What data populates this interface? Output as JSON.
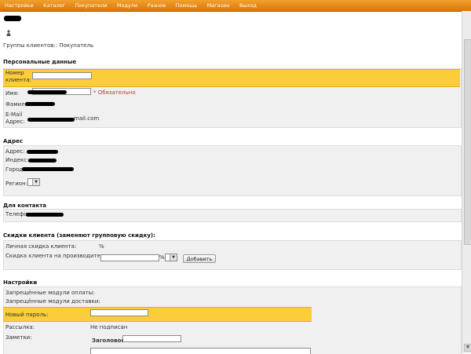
{
  "nav": {
    "items": [
      "Настройки",
      "Каталог",
      "Покупатели",
      "Модули",
      "Разное",
      "Помощь",
      "Магазин",
      "Выход"
    ]
  },
  "header": {
    "breadcrumb": "Группы клиентов:: Покупатель"
  },
  "personal": {
    "title": "Персональные данные",
    "customer_number_label": "Номер клиента:",
    "name_label": "Имя:",
    "required_note": "* Обязательно",
    "surname_label": "Фамилия:",
    "email_label": "E-Mail Адрес:",
    "email_visible": "mail.com"
  },
  "address": {
    "title": "Адрес",
    "address_label": "Адрес:",
    "index_label": "Индекс:",
    "city_label": "Город:",
    "region_label": "Регион:"
  },
  "contact": {
    "title": "Для контакта",
    "phone_label": "Телефон:"
  },
  "discounts": {
    "title": "Скидки клиента (заменяют групповую скидку):",
    "personal_label": "Личная скидка клиента:",
    "personal_unit": "%",
    "manufacturer_label": "Скидка клиента на производителя:",
    "manufacturer_unit": "%",
    "add_button": "Добавить"
  },
  "settings": {
    "title": "Настройки",
    "payment_modules_label": "Запрещённые модули оплаты:",
    "shipping_modules_label": "Запрещённые модули доставки:",
    "new_password_label": "Новый пароль:",
    "newsletter_label": "Рассылка:",
    "newsletter_value": "Не подписан",
    "notes_label": "Заметки:",
    "notes_title_label": "Заголовок:"
  },
  "colors": {
    "topbar": "#d9760b",
    "highlight": "#fbcd3a",
    "panel": "#f0f0f0",
    "required": "#c0392b"
  },
  "icons": {
    "person": "person-icon"
  }
}
